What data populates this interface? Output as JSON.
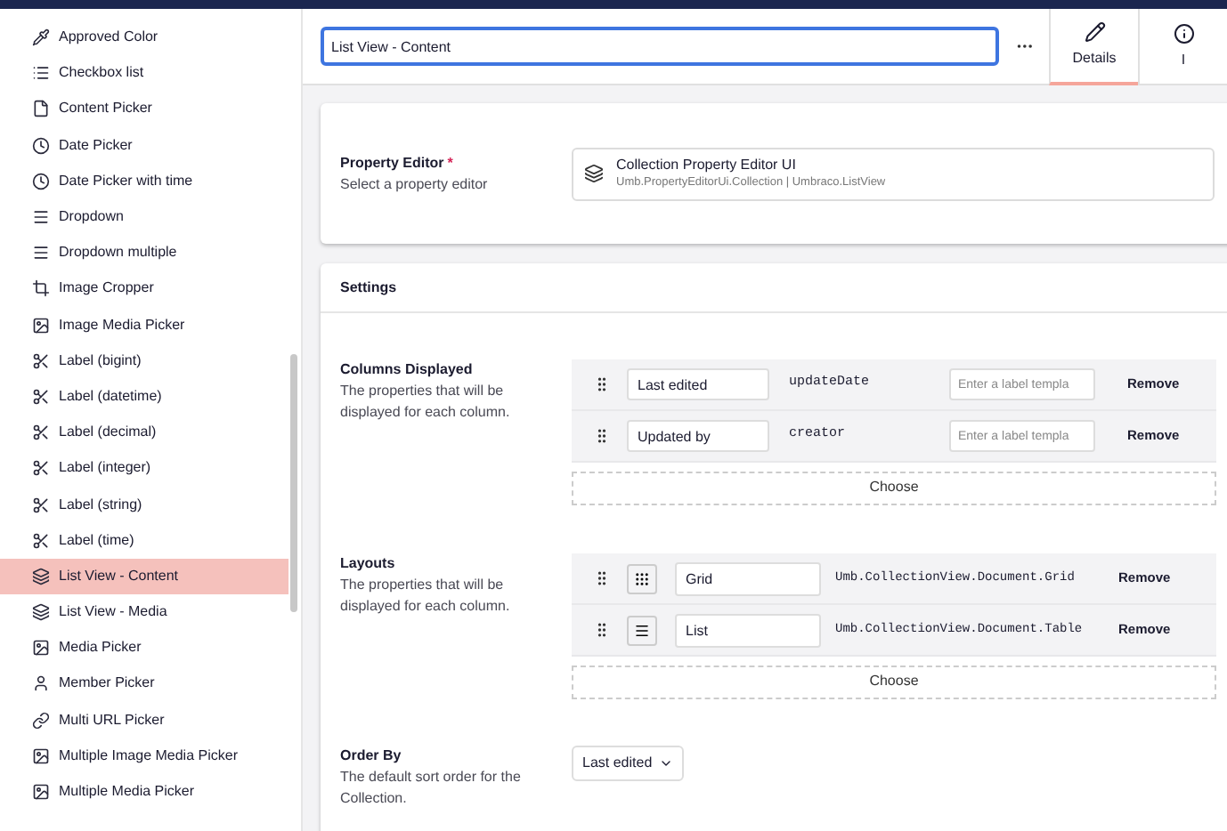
{
  "sidebar": {
    "items": [
      {
        "label": "Approved Color",
        "kind": "pipette",
        "selected": false
      },
      {
        "label": "Checkbox list",
        "kind": "list",
        "selected": false
      },
      {
        "label": "Content Picker",
        "kind": "file",
        "selected": false
      },
      {
        "label": "Date Picker",
        "kind": "clock",
        "selected": false
      },
      {
        "label": "Date Picker with time",
        "kind": "clock",
        "selected": false
      },
      {
        "label": "Dropdown",
        "kind": "lines",
        "selected": false
      },
      {
        "label": "Dropdown multiple",
        "kind": "lines",
        "selected": false
      },
      {
        "label": "Image Cropper",
        "kind": "crop",
        "selected": false
      },
      {
        "label": "Image Media Picker",
        "kind": "image",
        "selected": false
      },
      {
        "label": "Label (bigint)",
        "kind": "label",
        "selected": false
      },
      {
        "label": "Label (datetime)",
        "kind": "label",
        "selected": false
      },
      {
        "label": "Label (decimal)",
        "kind": "label",
        "selected": false
      },
      {
        "label": "Label (integer)",
        "kind": "label",
        "selected": false
      },
      {
        "label": "Label (string)",
        "kind": "label",
        "selected": false
      },
      {
        "label": "Label (time)",
        "kind": "label",
        "selected": false
      },
      {
        "label": "List View - Content",
        "kind": "layers",
        "selected": true
      },
      {
        "label": "List View - Media",
        "kind": "layers",
        "selected": false
      },
      {
        "label": "Media Picker",
        "kind": "image",
        "selected": false
      },
      {
        "label": "Member Picker",
        "kind": "user",
        "selected": false
      },
      {
        "label": "Multi URL Picker",
        "kind": "link",
        "selected": false
      },
      {
        "label": "Multiple Image Media Picker",
        "kind": "image",
        "selected": false
      },
      {
        "label": "Multiple Media Picker",
        "kind": "image",
        "selected": false
      }
    ]
  },
  "header": {
    "name_value": "List View - Content",
    "tabs": [
      {
        "label": "Details",
        "kind": "pencil",
        "selected": true
      },
      {
        "label": "I",
        "kind": "info",
        "selected": false
      }
    ]
  },
  "property_editor": {
    "label": "Property Editor",
    "required_mark": "*",
    "description": "Select a property editor",
    "editor_name": "Collection Property Editor UI",
    "editor_alias": "Umb.PropertyEditorUi.Collection | Umbraco.ListView"
  },
  "settings": {
    "title": "Settings",
    "columns_displayed": {
      "label": "Columns Displayed",
      "description": "The properties that will be displayed for each column.",
      "rows": [
        {
          "name": "Last edited",
          "alias": "updateDate",
          "template_placeholder": "Enter a label templa",
          "remove": "Remove"
        },
        {
          "name": "Updated by",
          "alias": "creator",
          "template_placeholder": "Enter a label templa",
          "remove": "Remove"
        }
      ],
      "choose": "Choose"
    },
    "layouts": {
      "label": "Layouts",
      "description": "The properties that will be displayed for each column.",
      "rows": [
        {
          "kind": "grid",
          "name": "Grid",
          "alias": "Umb.CollectionView.Document.Grid",
          "remove": "Remove"
        },
        {
          "kind": "list",
          "name": "List",
          "alias": "Umb.CollectionView.Document.Table",
          "remove": "Remove"
        }
      ],
      "choose": "Choose"
    },
    "order_by": {
      "label": "Order By",
      "description": "The default sort order for the Collection.",
      "value": "Last edited"
    }
  }
}
